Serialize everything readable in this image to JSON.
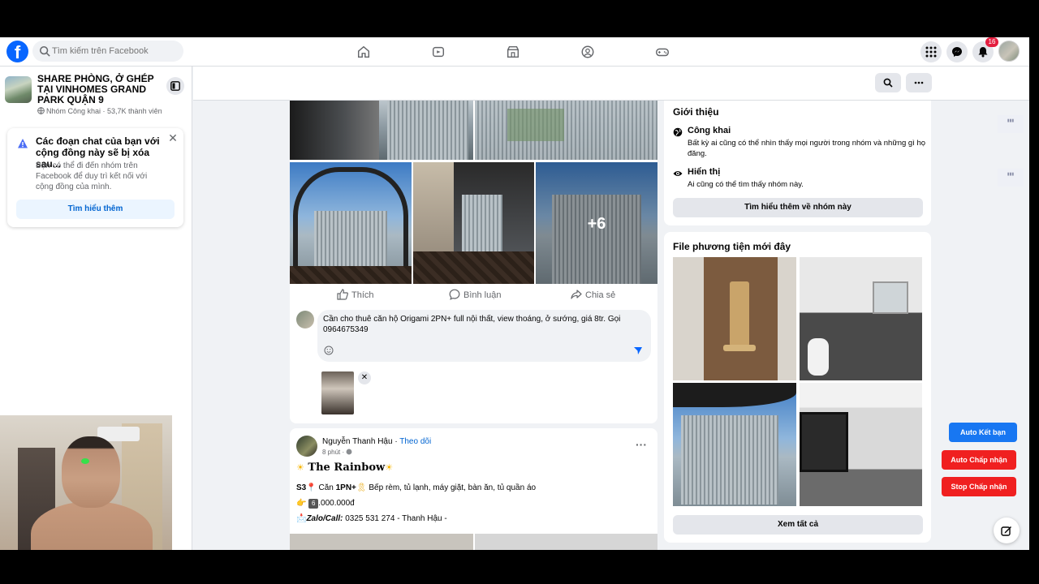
{
  "header": {
    "search_placeholder": "Tìm kiếm trên Facebook",
    "notification_count": "16",
    "tabs": [
      "home-icon",
      "watch-icon",
      "marketplace-icon",
      "groups-icon",
      "gaming-icon"
    ]
  },
  "group": {
    "name": "SHARE PHÒNG, Ở GHÉP TẠI VINHOMES GRAND PARK QUẬN 9",
    "meta": "Nhóm Công khai · 53,7K thành viên"
  },
  "notice": {
    "title": "Các đoạn chat của bạn với cộng đồng này sẽ bị xóa sau...",
    "body": "Bạn có thể đi đến nhóm trên Facebook để duy trì kết nối với cộng đồng của mình.",
    "button": "Tìm hiểu thêm"
  },
  "post1": {
    "more_photos": "+6",
    "actions": {
      "like": "Thích",
      "comment": "Bình luận",
      "share": "Chia sẻ"
    },
    "comment_text": "Cần cho thuê căn hộ Origami 2PN+ full nội thất, view thoáng, ở sướng, giá 8tr. Gọi 0964675349"
  },
  "post2": {
    "author": "Nguyễn Thanh Hậu",
    "follow": "Theo dõi",
    "time": "8 phút · ",
    "title": "The Rainbow",
    "line1_code": "S3",
    "line1_pre": " Căn ",
    "line1_type": "1PN+",
    "line1_rest": " Bếp rèm, tủ lạnh, máy giặt, bàn ăn, tủ quần áo",
    "line2_digit": "6",
    "line2": ".000.000đ",
    "line3_label": "Zalo/Call:",
    "line3_rest": " 0325 531 274 - Thanh Hậu -"
  },
  "intro": {
    "title": "Giới thiệu",
    "public_title": "Công khai",
    "public_desc": "Bất kỳ ai cũng có thể nhìn thấy mọi người trong nhóm và những gì họ đăng.",
    "visible_title": "Hiển thị",
    "visible_desc": "Ai cũng có thể tìm thấy nhóm này.",
    "learn_more": "Tìm hiểu thêm về nhóm này"
  },
  "media": {
    "title": "File phương tiện mới đây",
    "see_all": "Xem tất cả"
  },
  "tools": {
    "auto_friend": "Auto Kết bạn",
    "auto_accept": "Auto Chấp nhận",
    "stop_accept": "Stop Chấp nhận"
  },
  "colors": {
    "brand": "#0866ff",
    "tool_blue": "#1877f2",
    "tool_red": "#f02020"
  }
}
